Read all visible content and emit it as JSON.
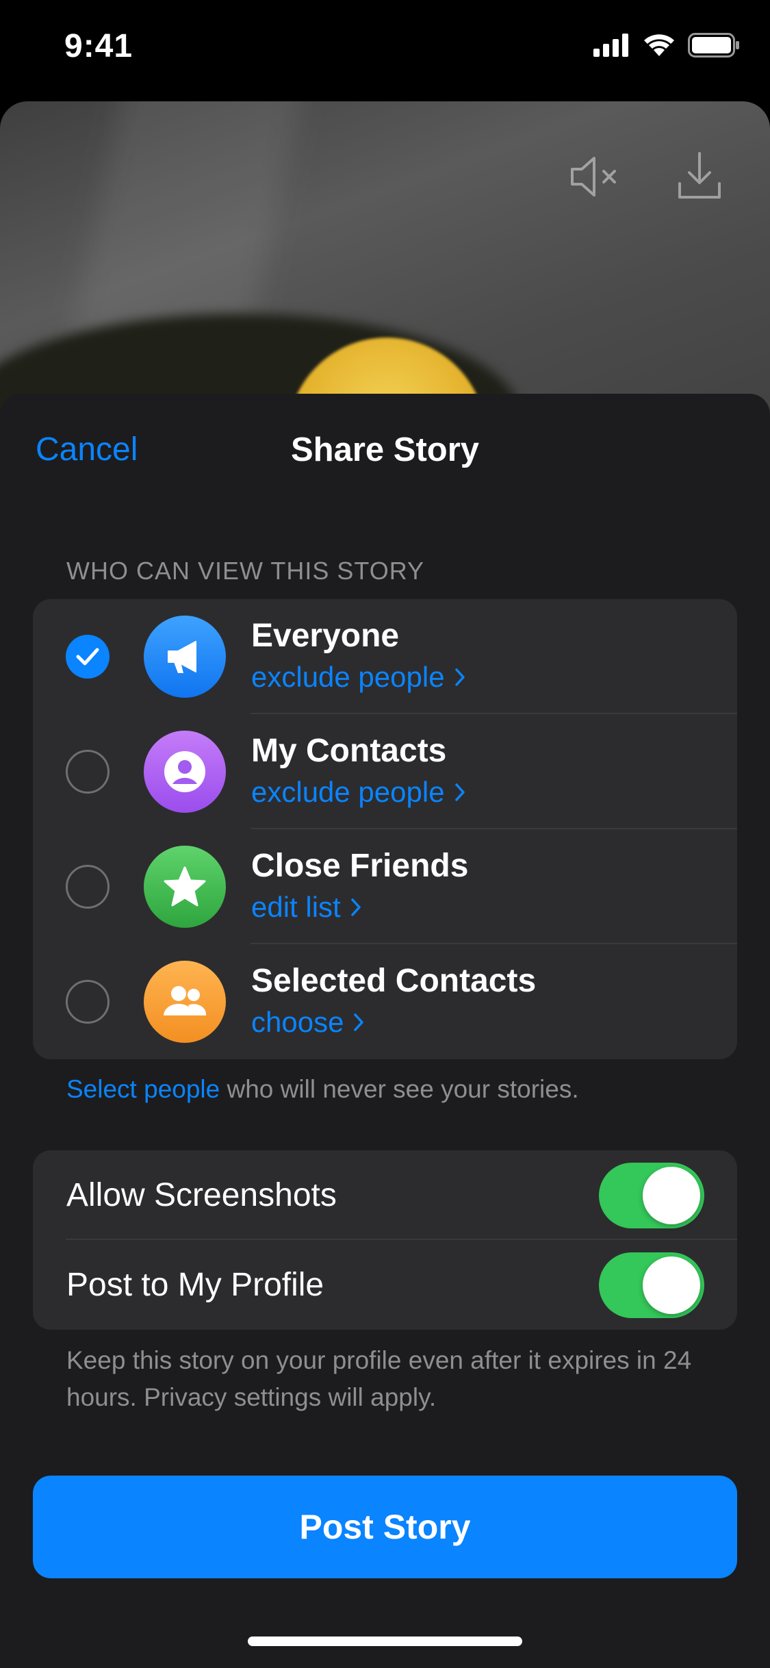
{
  "status_bar": {
    "time": "9:41"
  },
  "sheet": {
    "cancel_label": "Cancel",
    "title": "Share Story",
    "section_header": "WHO CAN VIEW THIS STORY",
    "audience_options": [
      {
        "title": "Everyone",
        "action": "exclude people",
        "selected": true,
        "icon": "megaphone-icon",
        "color": "#1a8cff"
      },
      {
        "title": "My Contacts",
        "action": "exclude people",
        "selected": false,
        "icon": "person-icon",
        "color": "#a25cf0"
      },
      {
        "title": "Close Friends",
        "action": "edit list",
        "selected": false,
        "icon": "star-icon",
        "color": "#3ab74a"
      },
      {
        "title": "Selected Contacts",
        "action": "choose",
        "selected": false,
        "icon": "people-icon",
        "color": "#f7a136"
      }
    ],
    "footer_link": "Select people",
    "footer_text": " who will never see your stories.",
    "toggles": [
      {
        "label": "Allow Screenshots",
        "on": true
      },
      {
        "label": "Post to My Profile",
        "on": true
      }
    ],
    "toggle_footer": "Keep this story on your profile even after it expires in 24 hours. Privacy settings will apply.",
    "post_label": "Post Story"
  },
  "colors": {
    "accent": "#0a84ff",
    "toggle_on": "#34c759",
    "sheet_bg": "#1c1c1e",
    "group_bg": "#2c2c2e"
  }
}
